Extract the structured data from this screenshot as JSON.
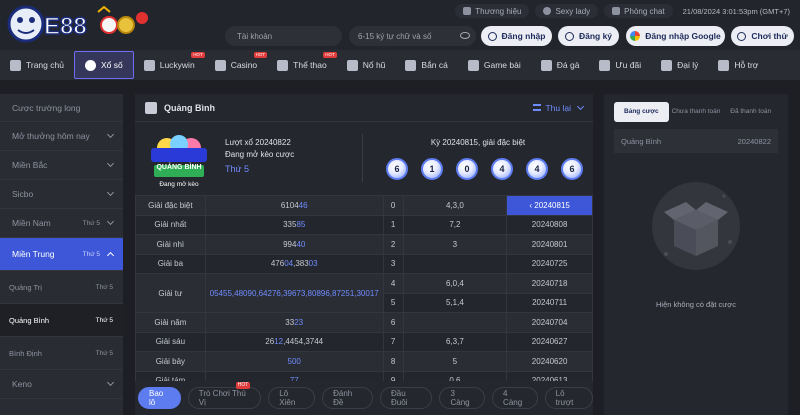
{
  "header": {
    "logo_text": "E88",
    "top_links": [
      {
        "label": "Thương hiệu",
        "icon": "brand-icon"
      },
      {
        "label": "Sexy lady",
        "icon": "heart-icon"
      },
      {
        "label": "Phòng chat",
        "icon": "chat-icon"
      }
    ],
    "clock": "21/08/2024 3:01:53pm (GMT+7)",
    "account_placeholder": "Tài khoản",
    "password_placeholder": "6-15 ký tự chữ và số",
    "login_label": "Đăng nhập",
    "register_label": "Đăng ký",
    "google_label": "Đăng nhập Google",
    "trial_label": "Chơi thử"
  },
  "nav": [
    {
      "label": "Trang chủ",
      "icon": "home-icon"
    },
    {
      "label": "Xổ số",
      "icon": "lottery-icon",
      "active": true
    },
    {
      "label": "Luckywin",
      "icon": "luckywin-icon",
      "hot": "HOT"
    },
    {
      "label": "Casino",
      "icon": "casino-icon",
      "hot": "HOT"
    },
    {
      "label": "Thể thao",
      "icon": "sports-icon",
      "hot": "HOT"
    },
    {
      "label": "Nổ hũ",
      "icon": "slot-icon"
    },
    {
      "label": "Bắn cá",
      "icon": "fish-icon"
    },
    {
      "label": "Game bài",
      "icon": "cards-icon"
    },
    {
      "label": "Đá gà",
      "icon": "rooster-icon"
    },
    {
      "label": "Ưu đãi",
      "icon": "gift-icon"
    },
    {
      "label": "Đại lý",
      "icon": "agent-icon"
    },
    {
      "label": "Hỗ trợ",
      "icon": "support-icon"
    }
  ],
  "sidebar": {
    "items": [
      {
        "label": "Cược trường long"
      },
      {
        "label": "Mở thưởng hôm nay",
        "chevron": true
      },
      {
        "label": "Miền Bắc",
        "chevron": true
      },
      {
        "label": "Sicbo",
        "chevron": true
      },
      {
        "label": "Miền Nam",
        "day": "Thứ 5",
        "chevron": true
      }
    ],
    "active": {
      "label": "Miền Trung",
      "day": "Thứ 5"
    },
    "subs": [
      {
        "label": "Quảng Trị",
        "day": "Thứ 5"
      },
      {
        "label": "Quảng Bình",
        "day": "Thứ 5",
        "selected": true
      },
      {
        "label": "Bình Định",
        "day": "Thứ 5"
      }
    ],
    "bottom": {
      "label": "Keno"
    }
  },
  "main": {
    "title": "Quảng Bình",
    "refresh_label": "Thu lại",
    "image_badge": "Đang mở kèo",
    "image_title": "QUẢNG BÌNH",
    "luot_xo": "Lượt xổ 20240822",
    "status": "Đang mở kèo cược",
    "day": "Thứ 5",
    "ky": "Kỳ 20240815, giải đặc biệt",
    "balls": [
      "6",
      "1",
      "0",
      "4",
      "4",
      "6"
    ],
    "prizes": [
      {
        "label": "Giải đặc biệt",
        "pre": "6104",
        "hl": "46"
      },
      {
        "label": "Giải nhất",
        "pre": "335",
        "hl": "85"
      },
      {
        "label": "Giải nhì",
        "pre": "994",
        "hl": "40"
      },
      {
        "label": "Giải ba",
        "pre": "476",
        "hl": "04",
        "mid": ",383",
        "hl2": "03"
      },
      {
        "label": "Giải tư",
        "text": "05455,48090,64276,39673,80896,87251,30017"
      },
      {
        "label": "Giải năm",
        "pre": "33",
        "hl": "23"
      },
      {
        "label": "Giải sáu",
        "pre": "26",
        "hl": "12",
        "rest": ",4454,3744"
      },
      {
        "label": "Giải bảy",
        "pre": "",
        "hl": "500"
      },
      {
        "label": "Giải tám",
        "pre": "",
        "hl": "77"
      }
    ],
    "heads": [
      {
        "h": "0",
        "t": "4,3,0"
      },
      {
        "h": "1",
        "t": "7,2"
      },
      {
        "h": "2",
        "t": "3"
      },
      {
        "h": "3",
        "t": ""
      },
      {
        "h": "4",
        "t": "6,0,4"
      },
      {
        "h": "5",
        "t": "5,1,4"
      },
      {
        "h": "6",
        "t": ""
      },
      {
        "h": "7",
        "t": "6,3,7"
      },
      {
        "h": "8",
        "t": "5"
      },
      {
        "h": "9",
        "t": "0,6"
      }
    ],
    "dates": [
      "20240815",
      "20240808",
      "20240801",
      "20240725",
      "20240718",
      "20240711",
      "20240704",
      "20240627",
      "20240620",
      "20240613"
    ],
    "tabs": [
      {
        "label": "Bao lô",
        "active": true
      },
      {
        "label": "Trò Chơi Thú Vị",
        "hot": "HOT"
      },
      {
        "label": "Lô Xiên"
      },
      {
        "label": "Đánh Đề"
      },
      {
        "label": "Đầu Đuôi"
      },
      {
        "label": "3 Càng"
      },
      {
        "label": "4 Càng"
      },
      {
        "label": "Lô trượt"
      }
    ]
  },
  "right": {
    "tabs": [
      "Bảng cược",
      "Chưa thanh toán",
      "Đã thanh toán"
    ],
    "row_label": "Quảng Bình",
    "row_value": "20240822",
    "empty_text": "Hiện không có đặt cược"
  },
  "colors": {
    "accent": "#3d57d8",
    "link": "#6f8cff",
    "bg": "#1e1f24",
    "panel": "#25272e"
  }
}
